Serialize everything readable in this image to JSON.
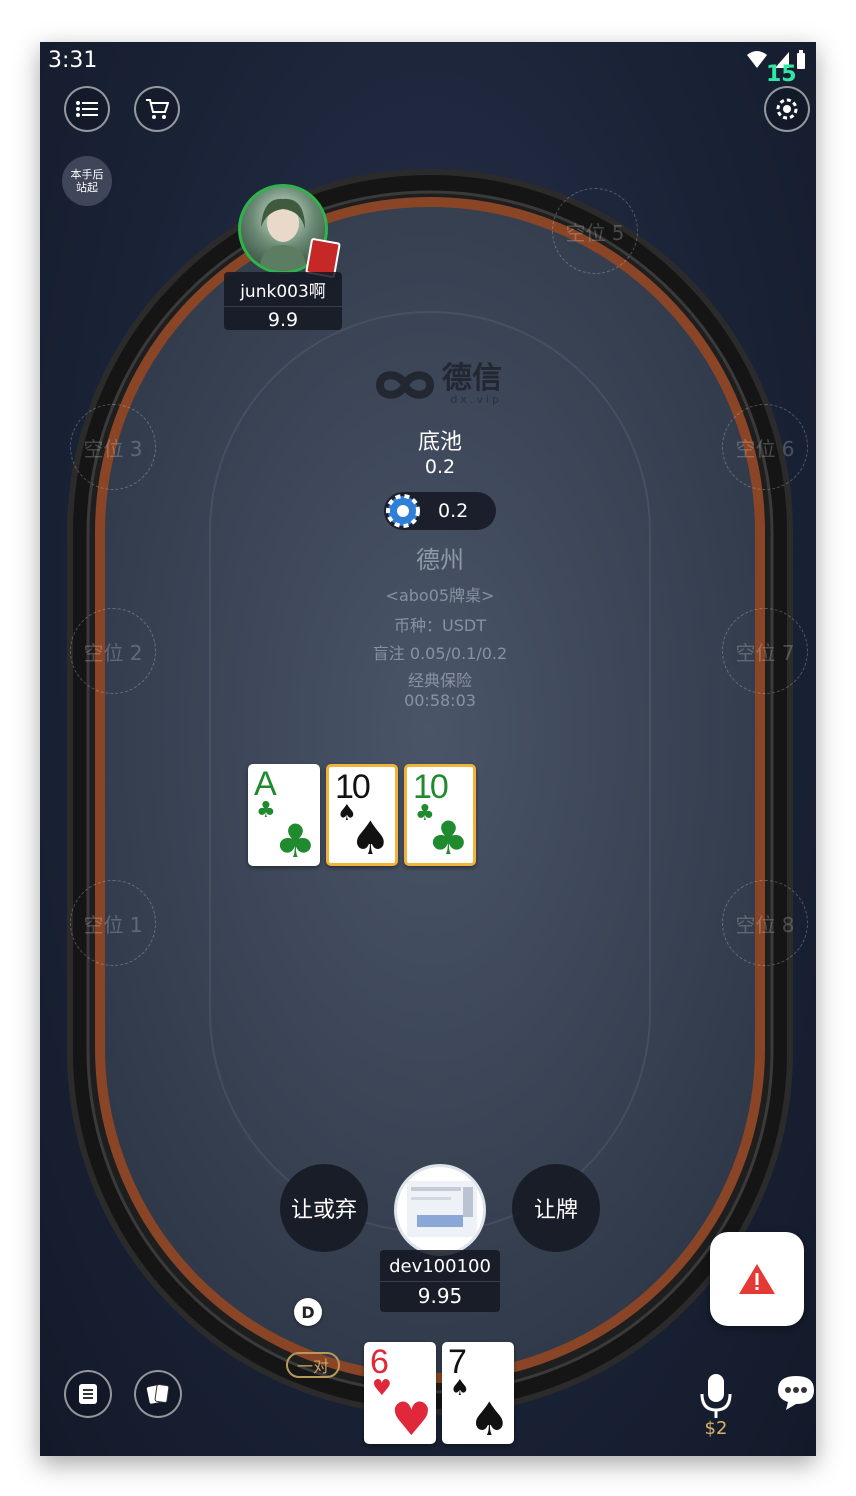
{
  "status": {
    "time": "3:31",
    "battery_level": "15"
  },
  "top_left": {
    "standup_label": "本手后\n站起"
  },
  "seats": {
    "s1": "空位 1",
    "s2": "空位 2",
    "s3": "空位 3",
    "s5": "空位 5",
    "s6": "空位 6",
    "s7": "空位 7",
    "s8": "空位 8"
  },
  "opponent": {
    "name": "junk003啊",
    "stack": "9.9"
  },
  "logo": {
    "brand": "德信",
    "domain": "dx.vip"
  },
  "pot": {
    "label": "底池",
    "value": "0.2",
    "chip_amount": "0.2"
  },
  "table_info": {
    "game": "德州",
    "table_name": "<abo05牌桌>",
    "currency": "币种：USDT",
    "blinds": "盲注 0.05/0.1/0.2",
    "insurance": "经典保险",
    "timer": "00:58:03"
  },
  "board_cards": [
    {
      "rank": "A",
      "suit": "♣",
      "color": "#1f8a2e",
      "highlight": false
    },
    {
      "rank": "10",
      "suit": "♠",
      "color": "#111111",
      "highlight": true
    },
    {
      "rank": "10",
      "suit": "♣",
      "color": "#1f8a2e",
      "highlight": true
    }
  ],
  "actions": {
    "check_fold": "让或弃",
    "check": "让牌"
  },
  "hero": {
    "name": "dev100100",
    "stack": "9.95",
    "dealer": "D",
    "hand_rank": "一对"
  },
  "hole_cards": [
    {
      "rank": "6",
      "suit": "♥",
      "color": "#e0283a"
    },
    {
      "rank": "7",
      "suit": "♠",
      "color": "#111111"
    }
  ],
  "bottom": {
    "mic_cost": "$2"
  },
  "colors": {
    "accent_red": "#e53935",
    "felt": "#3a4558",
    "rail": "#7a3e22"
  }
}
